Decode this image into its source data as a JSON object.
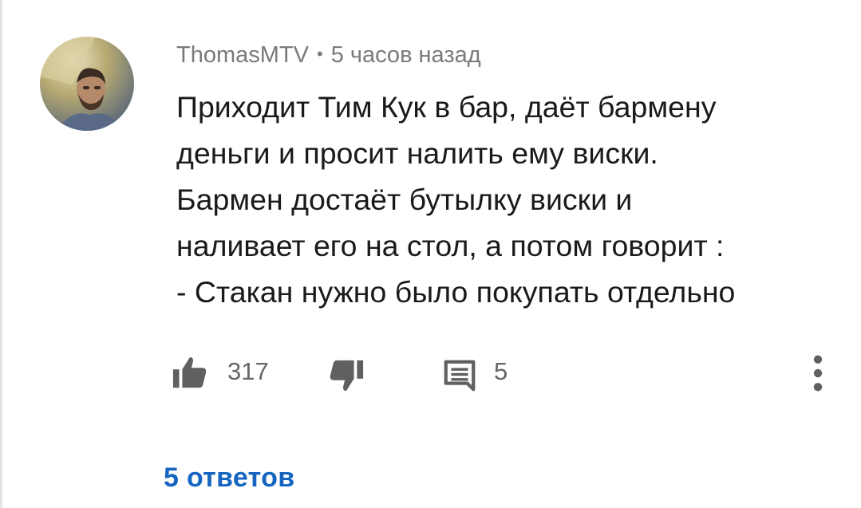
{
  "comment": {
    "author": "ThomasMTV",
    "separator": "•",
    "timestamp": "5 часов назад",
    "lines": [
      "Приходит Тим Кук в бар, даёт бармену",
      "деньги и просит налить ему виски.",
      "Бармен достаёт бутылку виски и",
      "наливает его на стол, а потом говорит :",
      "- Стакан нужно было покупать отдельно"
    ]
  },
  "actions": {
    "like_icon": "thumbs-up-icon",
    "like_count": "317",
    "dislike_icon": "thumbs-down-icon",
    "reply_icon": "reply-icon",
    "reply_count": "5",
    "more_icon": "more-vertical-icon"
  },
  "replies": {
    "label": "5 ответов"
  },
  "colors": {
    "author": "#7a7a7a",
    "text": "#1a1a1a",
    "icon": "#606060",
    "replies_link": "#1565c0"
  }
}
